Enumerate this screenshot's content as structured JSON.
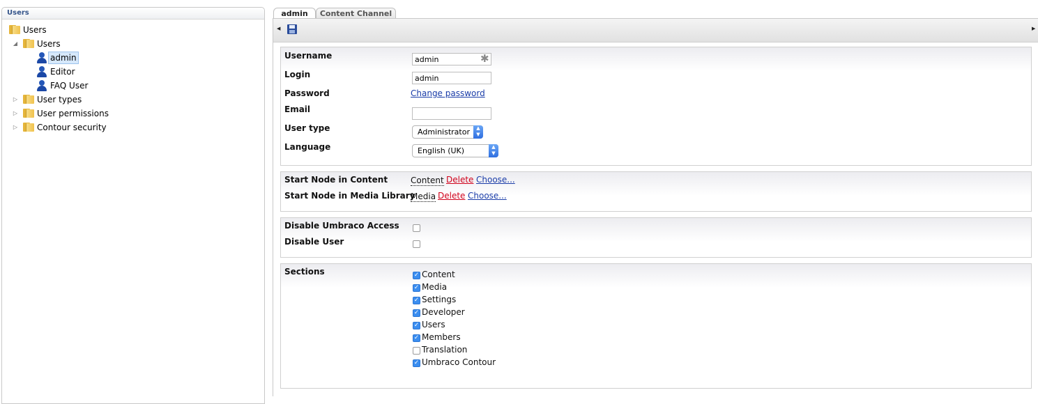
{
  "tree": {
    "header": "Users",
    "nodes": [
      {
        "label": "Users",
        "icon": "folder-icon"
      },
      {
        "label": "Users",
        "icon": "folder-icon",
        "expanded": true
      },
      {
        "label": "admin",
        "icon": "user-icon",
        "selected": true
      },
      {
        "label": "Editor",
        "icon": "user-icon"
      },
      {
        "label": "FAQ User",
        "icon": "user-icon"
      },
      {
        "label": "User types",
        "icon": "folder-icon"
      },
      {
        "label": "User permissions",
        "icon": "folder-icon"
      },
      {
        "label": "Contour security",
        "icon": "folder-icon"
      }
    ]
  },
  "tabs": [
    {
      "label": "admin",
      "active": true
    },
    {
      "label": "Content Channel",
      "active": false
    }
  ],
  "toolbar": {
    "save_icon": "save-icon"
  },
  "account": {
    "username_label": "Username",
    "username_value": "admin",
    "login_label": "Login",
    "login_value": "admin",
    "password_label": "Password",
    "change_password": "Change password",
    "email_label": "Email",
    "email_value": "",
    "user_type_label": "User type",
    "user_type_value": "Administrator",
    "language_label": "Language",
    "language_value": "English (UK)"
  },
  "start_nodes": {
    "content_label": "Start Node in Content",
    "content_value": "Content",
    "media_label": "Start Node in Media Library",
    "media_value": "Media",
    "delete": "Delete",
    "choose": "Choose..."
  },
  "access": {
    "disable_umbraco_label": "Disable Umbraco Access",
    "disable_user_label": "Disable User"
  },
  "sections": {
    "label": "Sections",
    "items": [
      {
        "label": "Content",
        "checked": true
      },
      {
        "label": "Media",
        "checked": true
      },
      {
        "label": "Settings",
        "checked": true
      },
      {
        "label": "Developer",
        "checked": true
      },
      {
        "label": "Users",
        "checked": true
      },
      {
        "label": "Members",
        "checked": true
      },
      {
        "label": "Translation",
        "checked": false
      },
      {
        "label": "Umbraco Contour",
        "checked": true
      }
    ]
  }
}
